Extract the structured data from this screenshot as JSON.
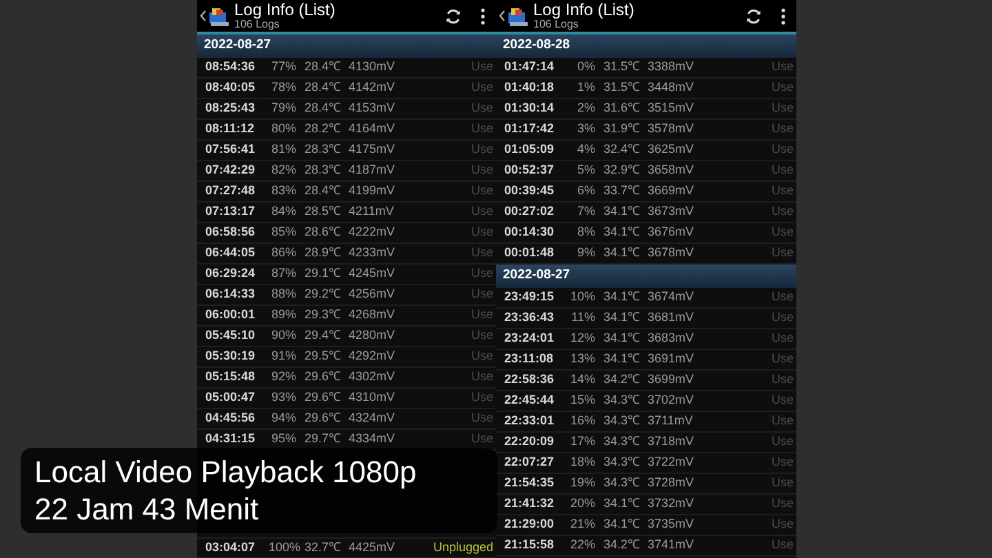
{
  "panels": [
    {
      "title": "Log Info (List)",
      "subtitle": "106 Logs",
      "sections": [
        {
          "date": "2022-08-27",
          "rows": [
            {
              "time": "08:54:36",
              "percent": "77%",
              "temp": "28.4℃",
              "voltage": "4130mV",
              "status": "Use",
              "kind": "use"
            },
            {
              "time": "08:40:05",
              "percent": "78%",
              "temp": "28.4℃",
              "voltage": "4142mV",
              "status": "Use",
              "kind": "use"
            },
            {
              "time": "08:25:43",
              "percent": "79%",
              "temp": "28.4℃",
              "voltage": "4153mV",
              "status": "Use",
              "kind": "use"
            },
            {
              "time": "08:11:12",
              "percent": "80%",
              "temp": "28.2℃",
              "voltage": "4164mV",
              "status": "Use",
              "kind": "use"
            },
            {
              "time": "07:56:41",
              "percent": "81%",
              "temp": "28.3℃",
              "voltage": "4175mV",
              "status": "Use",
              "kind": "use"
            },
            {
              "time": "07:42:29",
              "percent": "82%",
              "temp": "28.3℃",
              "voltage": "4187mV",
              "status": "Use",
              "kind": "use"
            },
            {
              "time": "07:27:48",
              "percent": "83%",
              "temp": "28.4℃",
              "voltage": "4199mV",
              "status": "Use",
              "kind": "use"
            },
            {
              "time": "07:13:17",
              "percent": "84%",
              "temp": "28.5℃",
              "voltage": "4211mV",
              "status": "Use",
              "kind": "use"
            },
            {
              "time": "06:58:56",
              "percent": "85%",
              "temp": "28.6℃",
              "voltage": "4222mV",
              "status": "Use",
              "kind": "use"
            },
            {
              "time": "06:44:05",
              "percent": "86%",
              "temp": "28.9℃",
              "voltage": "4233mV",
              "status": "Use",
              "kind": "use"
            },
            {
              "time": "06:29:24",
              "percent": "87%",
              "temp": "29.1℃",
              "voltage": "4245mV",
              "status": "Use",
              "kind": "use"
            },
            {
              "time": "06:14:33",
              "percent": "88%",
              "temp": "29.2℃",
              "voltage": "4256mV",
              "status": "Use",
              "kind": "use"
            },
            {
              "time": "06:00:01",
              "percent": "89%",
              "temp": "29.3℃",
              "voltage": "4268mV",
              "status": "Use",
              "kind": "use"
            },
            {
              "time": "05:45:10",
              "percent": "90%",
              "temp": "29.4℃",
              "voltage": "4280mV",
              "status": "Use",
              "kind": "use"
            },
            {
              "time": "05:30:19",
              "percent": "91%",
              "temp": "29.5℃",
              "voltage": "4292mV",
              "status": "Use",
              "kind": "use"
            },
            {
              "time": "05:15:48",
              "percent": "92%",
              "temp": "29.6℃",
              "voltage": "4302mV",
              "status": "Use",
              "kind": "use"
            },
            {
              "time": "05:00:47",
              "percent": "93%",
              "temp": "29.6℃",
              "voltage": "4310mV",
              "status": "Use",
              "kind": "use"
            },
            {
              "time": "04:45:56",
              "percent": "94%",
              "temp": "29.6℃",
              "voltage": "4324mV",
              "status": "Use",
              "kind": "use"
            },
            {
              "time": "04:31:15",
              "percent": "95%",
              "temp": "29.7℃",
              "voltage": "4334mV",
              "status": "Use",
              "kind": "use"
            }
          ],
          "last_row": {
            "time": "03:04:07",
            "percent": "100%",
            "temp": "32.7℃",
            "voltage": "4425mV",
            "status": "Unplugged",
            "kind": "unplugged"
          }
        }
      ]
    },
    {
      "title": "Log Info (List)",
      "subtitle": "106 Logs",
      "sections": [
        {
          "date": "2022-08-28",
          "rows": [
            {
              "time": "01:47:14",
              "percent": "0%",
              "temp": "31.5℃",
              "voltage": "3388mV",
              "status": "Use",
              "kind": "use"
            },
            {
              "time": "01:40:18",
              "percent": "1%",
              "temp": "31.5℃",
              "voltage": "3448mV",
              "status": "Use",
              "kind": "use"
            },
            {
              "time": "01:30:14",
              "percent": "2%",
              "temp": "31.6℃",
              "voltage": "3515mV",
              "status": "Use",
              "kind": "use"
            },
            {
              "time": "01:17:42",
              "percent": "3%",
              "temp": "31.9℃",
              "voltage": "3578mV",
              "status": "Use",
              "kind": "use"
            },
            {
              "time": "01:05:09",
              "percent": "4%",
              "temp": "32.4℃",
              "voltage": "3625mV",
              "status": "Use",
              "kind": "use"
            },
            {
              "time": "00:52:37",
              "percent": "5%",
              "temp": "32.9℃",
              "voltage": "3658mV",
              "status": "Use",
              "kind": "use"
            },
            {
              "time": "00:39:45",
              "percent": "6%",
              "temp": "33.7℃",
              "voltage": "3669mV",
              "status": "Use",
              "kind": "use"
            },
            {
              "time": "00:27:02",
              "percent": "7%",
              "temp": "34.1℃",
              "voltage": "3673mV",
              "status": "Use",
              "kind": "use"
            },
            {
              "time": "00:14:30",
              "percent": "8%",
              "temp": "34.1℃",
              "voltage": "3676mV",
              "status": "Use",
              "kind": "use"
            },
            {
              "time": "00:01:48",
              "percent": "9%",
              "temp": "34.1℃",
              "voltage": "3678mV",
              "status": "Use",
              "kind": "use"
            }
          ]
        },
        {
          "date": "2022-08-27",
          "rows": [
            {
              "time": "23:49:15",
              "percent": "10%",
              "temp": "34.1℃",
              "voltage": "3674mV",
              "status": "Use",
              "kind": "use"
            },
            {
              "time": "23:36:43",
              "percent": "11%",
              "temp": "34.1℃",
              "voltage": "3681mV",
              "status": "Use",
              "kind": "use"
            },
            {
              "time": "23:24:01",
              "percent": "12%",
              "temp": "34.1℃",
              "voltage": "3683mV",
              "status": "Use",
              "kind": "use"
            },
            {
              "time": "23:11:08",
              "percent": "13%",
              "temp": "34.1℃",
              "voltage": "3691mV",
              "status": "Use",
              "kind": "use"
            },
            {
              "time": "22:58:36",
              "percent": "14%",
              "temp": "34.2℃",
              "voltage": "3699mV",
              "status": "Use",
              "kind": "use"
            },
            {
              "time": "22:45:44",
              "percent": "15%",
              "temp": "34.3℃",
              "voltage": "3702mV",
              "status": "Use",
              "kind": "use"
            },
            {
              "time": "22:33:01",
              "percent": "16%",
              "temp": "34.3℃",
              "voltage": "3711mV",
              "status": "Use",
              "kind": "use"
            },
            {
              "time": "22:20:09",
              "percent": "17%",
              "temp": "34.3℃",
              "voltage": "3718mV",
              "status": "Use",
              "kind": "use"
            },
            {
              "time": "22:07:27",
              "percent": "18%",
              "temp": "34.3℃",
              "voltage": "3722mV",
              "status": "Use",
              "kind": "use"
            },
            {
              "time": "21:54:35",
              "percent": "19%",
              "temp": "34.3℃",
              "voltage": "3728mV",
              "status": "Use",
              "kind": "use"
            },
            {
              "time": "21:41:32",
              "percent": "20%",
              "temp": "34.1℃",
              "voltage": "3732mV",
              "status": "Use",
              "kind": "use"
            },
            {
              "time": "21:29:00",
              "percent": "21%",
              "temp": "34.1℃",
              "voltage": "3735mV",
              "status": "Use",
              "kind": "use"
            },
            {
              "time": "21:15:58",
              "percent": "22%",
              "temp": "34.2℃",
              "voltage": "3741mV",
              "status": "Use",
              "kind": "use"
            }
          ]
        }
      ]
    }
  ],
  "caption": [
    "Local Video Playback 1080p",
    "22 Jam 43 Menit"
  ]
}
